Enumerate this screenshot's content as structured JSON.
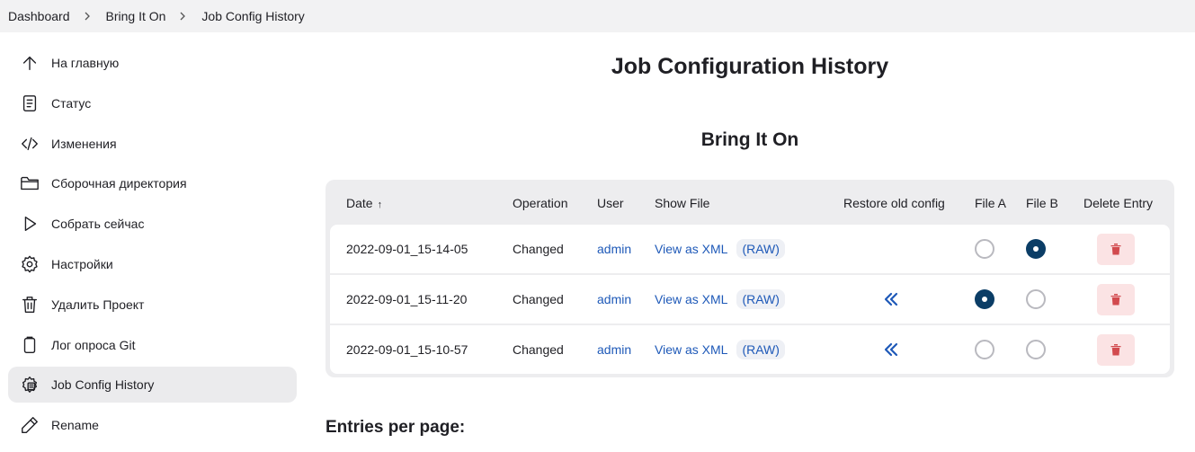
{
  "breadcrumb": [
    "Dashboard",
    "Bring It On",
    "Job Config History"
  ],
  "sidebar": {
    "items": [
      {
        "label": "На главную",
        "icon": "arrow-up-icon"
      },
      {
        "label": "Статус",
        "icon": "document-icon"
      },
      {
        "label": "Изменения",
        "icon": "code-icon"
      },
      {
        "label": "Сборочная директория",
        "icon": "folder-icon"
      },
      {
        "label": "Собрать сейчас",
        "icon": "play-icon"
      },
      {
        "label": "Настройки",
        "icon": "gear-icon"
      },
      {
        "label": "Удалить Проект",
        "icon": "trash-icon"
      },
      {
        "label": "Лог опроса Git",
        "icon": "clipboard-icon"
      },
      {
        "label": "Job Config History",
        "icon": "config-history-icon"
      },
      {
        "label": "Rename",
        "icon": "pencil-icon"
      }
    ],
    "active_index": 8
  },
  "page_title": "Job Configuration History",
  "job_title": "Bring It On",
  "table": {
    "headers": {
      "date": "Date",
      "date_sort": "↑",
      "operation": "Operation",
      "user": "User",
      "show_file": "Show File",
      "restore": "Restore old config",
      "file_a": "File A",
      "file_b": "File B",
      "delete": "Delete Entry"
    },
    "rows": [
      {
        "date": "2022-09-01_15-14-05",
        "operation": "Changed",
        "user": "admin",
        "view": "View as XML",
        "raw": "(RAW)",
        "restore": false,
        "file_a": false,
        "file_b": true
      },
      {
        "date": "2022-09-01_15-11-20",
        "operation": "Changed",
        "user": "admin",
        "view": "View as XML",
        "raw": "(RAW)",
        "restore": true,
        "file_a": true,
        "file_b": false
      },
      {
        "date": "2022-09-01_15-10-57",
        "operation": "Changed",
        "user": "admin",
        "view": "View as XML",
        "raw": "(RAW)",
        "restore": true,
        "file_a": false,
        "file_b": false
      }
    ]
  },
  "entries_per_page_label": "Entries per page:",
  "colors": {
    "link": "#1e59b8",
    "radio_checked": "#0b3d66",
    "delete_bg": "#fbe3e4",
    "delete_icon": "#d24a4e"
  }
}
